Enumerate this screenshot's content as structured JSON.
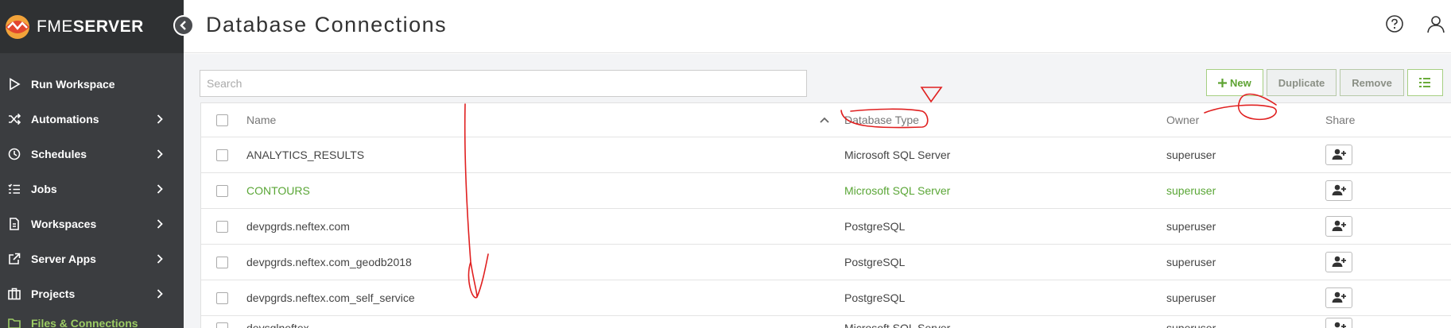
{
  "brand": {
    "fme": "FME",
    "server": "SERVER"
  },
  "sidebar": {
    "items": [
      {
        "label": "Run Workspace",
        "icon": "play-icon",
        "has_chevron": false
      },
      {
        "label": "Automations",
        "icon": "shuffle-icon",
        "has_chevron": true
      },
      {
        "label": "Schedules",
        "icon": "clock-icon",
        "has_chevron": true
      },
      {
        "label": "Jobs",
        "icon": "list-icon",
        "has_chevron": true
      },
      {
        "label": "Workspaces",
        "icon": "document-icon",
        "has_chevron": true
      },
      {
        "label": "Server Apps",
        "icon": "external-link-icon",
        "has_chevron": true
      },
      {
        "label": "Projects",
        "icon": "briefcase-icon",
        "has_chevron": true
      },
      {
        "label": "Files & Connections",
        "icon": "folder-icon",
        "has_chevron": true
      }
    ]
  },
  "header": {
    "title": "Database Connections"
  },
  "search": {
    "placeholder": "Search"
  },
  "toolbar": {
    "new_label": "New",
    "duplicate_label": "Duplicate",
    "remove_label": "Remove"
  },
  "table": {
    "columns": {
      "name": "Name",
      "type": "Database Type",
      "owner": "Owner",
      "share": "Share"
    },
    "rows": [
      {
        "name": "ANALYTICS_RESULTS",
        "type": "Microsoft SQL Server",
        "owner": "superuser"
      },
      {
        "name": "CONTOURS",
        "type": "Microsoft SQL Server",
        "owner": "superuser",
        "highlight": true
      },
      {
        "name": "devpgrds.neftex.com",
        "type": "PostgreSQL",
        "owner": "superuser"
      },
      {
        "name": "devpgrds.neftex.com_geodb2018",
        "type": "PostgreSQL",
        "owner": "superuser"
      },
      {
        "name": "devpgrds.neftex.com_self_service",
        "type": "PostgreSQL",
        "owner": "superuser"
      },
      {
        "name": "devsqlneftex",
        "type": "Microsoft SQL Server",
        "owner": "superuser"
      }
    ]
  },
  "colors": {
    "accent_green": "#5aa636",
    "sidebar_bg": "#3b3d40",
    "annotation_red": "#e02020"
  }
}
